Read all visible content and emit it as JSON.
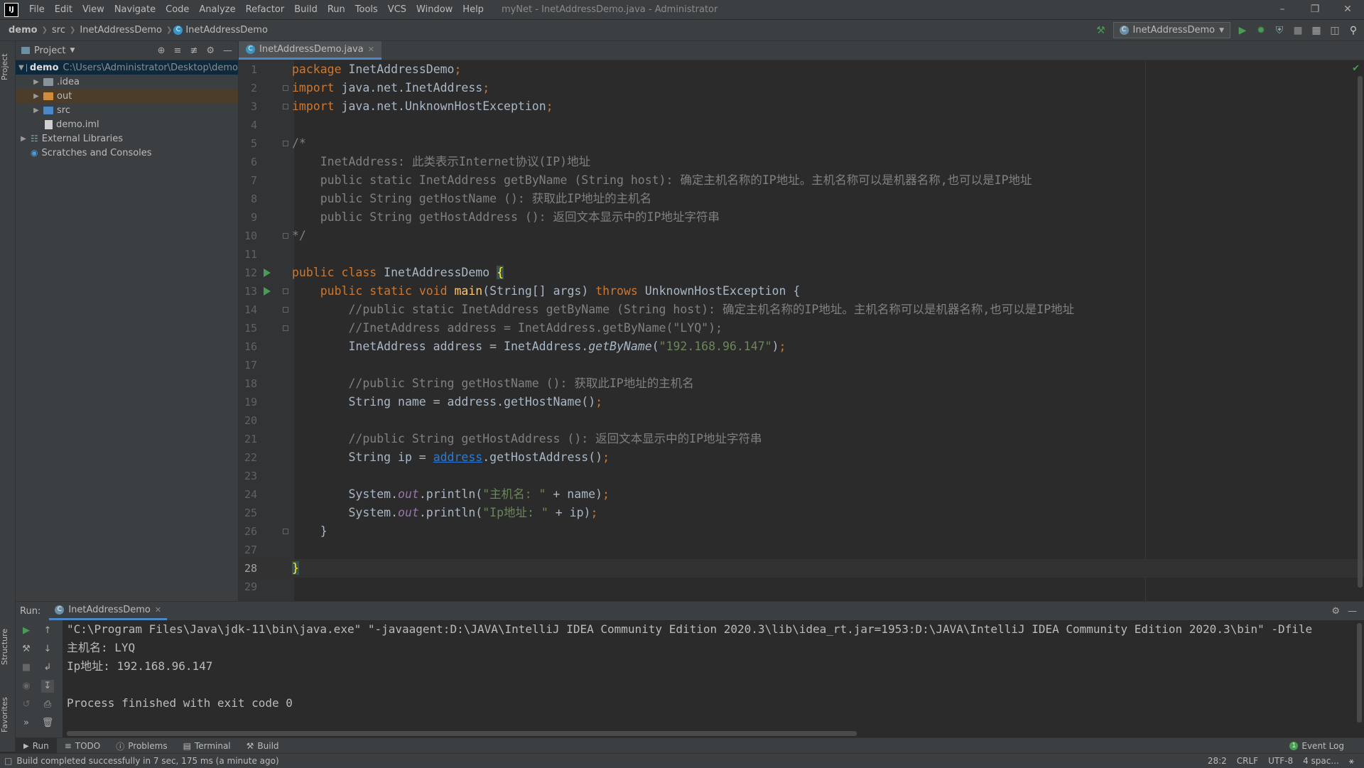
{
  "app": {
    "logo": "IJ",
    "window_title": "myNet - InetAddressDemo.java - Administrator",
    "menu": [
      "File",
      "Edit",
      "View",
      "Navigate",
      "Code",
      "Analyze",
      "Refactor",
      "Build",
      "Run",
      "Tools",
      "VCS",
      "Window",
      "Help"
    ]
  },
  "breadcrumb": [
    "demo",
    "src",
    "InetAddressDemo",
    "InetAddressDemo"
  ],
  "toolbar": {
    "run_config": "InetAddressDemo"
  },
  "left_strip": {
    "project": "Project",
    "structure": "Structure",
    "favorites": "Favorites"
  },
  "project_panel": {
    "title": "Project",
    "tree": [
      {
        "label": "demo",
        "hint": "C:\\Users\\Administrator\\Desktop\\demo"
      },
      {
        "label": ".idea"
      },
      {
        "label": "out"
      },
      {
        "label": "src"
      },
      {
        "label": "demo.iml"
      },
      {
        "label": "External Libraries"
      },
      {
        "label": "Scratches and Consoles"
      }
    ]
  },
  "editor": {
    "tab": "InetAddressDemo.java",
    "current_line": 28,
    "lines": [
      [
        [
          "kw",
          "package "
        ],
        [
          "",
          "InetAddressDemo"
        ],
        [
          "kw",
          ";"
        ]
      ],
      [
        [
          "kw",
          "import "
        ],
        [
          "",
          "java.net.InetAddress"
        ],
        [
          "kw",
          ";"
        ]
      ],
      [
        [
          "kw",
          "import "
        ],
        [
          "",
          "java.net.UnknownHostException"
        ],
        [
          "kw",
          ";"
        ]
      ],
      [],
      [
        [
          "cmt",
          "/*"
        ]
      ],
      [
        [
          "cmt",
          "    InetAddress: 此类表示Internet协议(IP)地址"
        ]
      ],
      [
        [
          "cmt",
          "    public static InetAddress getByName (String host): 确定主机名称的IP地址。主机名称可以是机器名称,也可以是IP地址"
        ]
      ],
      [
        [
          "cmt",
          "    public String getHostName (): 获取此IP地址的主机名"
        ]
      ],
      [
        [
          "cmt",
          "    public String getHostAddress (): 返回文本显示中的IP地址字符串"
        ]
      ],
      [
        [
          "cmt",
          "*/"
        ]
      ],
      [],
      [
        [
          "kw",
          "public class "
        ],
        [
          "",
          "InetAddressDemo "
        ],
        [
          "brace",
          "{"
        ]
      ],
      [
        [
          "",
          "    "
        ],
        [
          "kw",
          "public static void "
        ],
        [
          "mth",
          "main"
        ],
        [
          "",
          "(String[] args) "
        ],
        [
          "kw",
          "throws "
        ],
        [
          "",
          "UnknownHostException {"
        ]
      ],
      [
        [
          "cmt",
          "        //public static InetAddress getByName (String host): 确定主机名称的IP地址。主机名称可以是机器名称,也可以是IP地址"
        ]
      ],
      [
        [
          "cmt",
          "        //InetAddress address = InetAddress.getByName(\"LYQ\");"
        ]
      ],
      [
        [
          "",
          "        InetAddress address = InetAddress."
        ],
        [
          "itl",
          "getByName"
        ],
        [
          "",
          "("
        ],
        [
          "str",
          "\"192.168.96.147\""
        ],
        [
          "",
          ")"
        ],
        [
          "kw",
          ";"
        ]
      ],
      [],
      [
        [
          "cmt",
          "        //public String getHostName (): 获取此IP地址的主机名"
        ]
      ],
      [
        [
          "",
          "        String name = address.getHostName()"
        ],
        [
          "kw",
          ";"
        ]
      ],
      [],
      [
        [
          "cmt",
          "        //public String getHostAddress (): 返回文本显示中的IP地址字符串"
        ]
      ],
      [
        [
          "",
          "        String ip = "
        ],
        [
          "lnk",
          "address"
        ],
        [
          "",
          ".getHostAddress()"
        ],
        [
          "kw",
          ";"
        ]
      ],
      [],
      [
        [
          "",
          "        System."
        ],
        [
          "fld",
          "out"
        ],
        [
          "",
          ".println("
        ],
        [
          "str",
          "\"主机名: \""
        ],
        [
          "",
          " + name)"
        ],
        [
          "kw",
          ";"
        ]
      ],
      [
        [
          "",
          "        System."
        ],
        [
          "fld",
          "out"
        ],
        [
          "",
          ".println("
        ],
        [
          "str",
          "\"Ip地址: \""
        ],
        [
          "",
          " + ip)"
        ],
        [
          "kw",
          ";"
        ]
      ],
      [
        [
          "",
          "    }"
        ]
      ],
      [],
      [
        [
          "brace",
          "}"
        ]
      ],
      []
    ]
  },
  "run_panel": {
    "label": "Run:",
    "tab": "InetAddressDemo",
    "console": [
      "\"C:\\Program Files\\Java\\jdk-11\\bin\\java.exe\" \"-javaagent:D:\\JAVA\\IntelliJ IDEA Community Edition 2020.3\\lib\\idea_rt.jar=1953:D:\\JAVA\\IntelliJ IDEA Community Edition 2020.3\\bin\" -Dfile",
      "主机名: LYQ",
      "Ip地址: 192.168.96.147",
      "",
      "Process finished with exit code 0"
    ]
  },
  "tool_tabs": {
    "run": "Run",
    "todo": "TODO",
    "problems": "Problems",
    "terminal": "Terminal",
    "build": "Build",
    "event_log": "Event Log"
  },
  "status": {
    "message": "Build completed successfully in 7 sec, 175 ms (a minute ago)",
    "position": "28:2",
    "line_sep": "CRLF",
    "encoding": "UTF-8",
    "indent": "4 spac..."
  },
  "colors": {
    "accent": "#4a88c7",
    "run_green": "#499c54",
    "keyword": "#cc7832",
    "string": "#6a8759",
    "comment": "#808080"
  }
}
